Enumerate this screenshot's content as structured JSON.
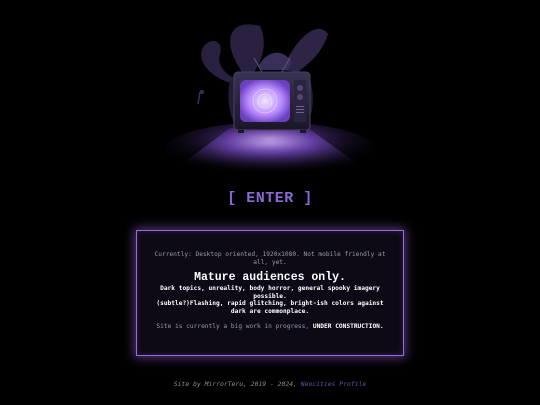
{
  "enter": {
    "label": "[ ENTER ]"
  },
  "warning": {
    "desktop_note": "Currently: Desktop oriented, 1920x1080. Not mobile friendly at all, yet.",
    "heading": "Mature audiences only.",
    "line1": "Dark topics, unreality, body horror, general spooky imagery possible.",
    "line2": "(subtle?)Flashing, rapid glitching, bright-ish colors against dark are commonplace.",
    "construction_prefix": "Site is currently a big work in progress, ",
    "construction_emphasis": "UNDER CONSTRUCTION."
  },
  "footer": {
    "credit": "Site by MirrorTeru, 2019 - 2024, ",
    "link_label": "Neocities Profile"
  },
  "colors": {
    "accent": "#8b68d6",
    "border": "#9b6ad8",
    "background": "#000000",
    "screen_glow": "#c9a8ff"
  },
  "hero": {
    "icon": "crt-tv-creature-icon"
  }
}
